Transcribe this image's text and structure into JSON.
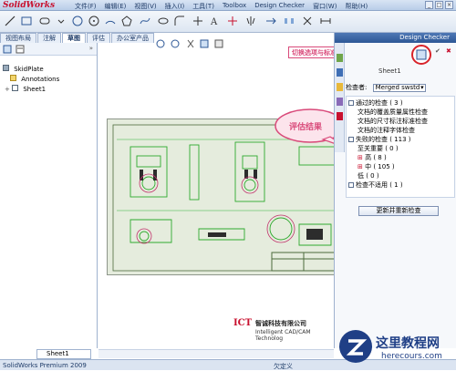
{
  "app": {
    "logo": "SolidWorks"
  },
  "menu": [
    "文件(F)",
    "编辑(E)",
    "视图(V)",
    "插入(I)",
    "工具(T)",
    "Toolbox",
    "Design Checker",
    "窗口(W)",
    "帮助(H)"
  ],
  "tabs": [
    "视图布局",
    "注解",
    "草图",
    "评估",
    "办公室产品"
  ],
  "tabs_active": 2,
  "tree": {
    "root": "SkidPlate",
    "items": [
      "Annotations",
      "Sheet1"
    ]
  },
  "design_checker": {
    "title": "Design Checker",
    "sheet_label": "Sheet1",
    "checker_label": "检查者:",
    "checker_value": "Merged swstd",
    "passed": "通过的检查 ( 3 )",
    "passed_items": [
      "文档的覆盖质量属性检查",
      "文档的尺寸标注标准检查",
      "文档的注释字体检查"
    ],
    "failed": "失败的检查 ( 113 )",
    "critical": "至关重要 ( 0 )",
    "high": "高 ( 8 )",
    "medium": "中 ( 105 )",
    "low": "低 ( 0 )",
    "not_applicable": "检查不适用 ( 1 )",
    "recheck_button": "更新并重新检查"
  },
  "callouts": {
    "switch": "切换选项与标准显示",
    "evaluate": "评估结果"
  },
  "ict": {
    "mark": "ICT",
    "cn": "智诚科技有限公司",
    "en": "Intelligent CAD/CAM Technolog"
  },
  "sheet_tab": "Sheet1",
  "status": {
    "left": "SolidWorks Premium 2009",
    "right": "欠定义"
  },
  "watermark": {
    "cn": "这里教程网",
    "url": "herecours.com"
  },
  "colors": {
    "accent": "#2d5796",
    "callout": "#d94a7a",
    "highlight": "#d8232a"
  }
}
